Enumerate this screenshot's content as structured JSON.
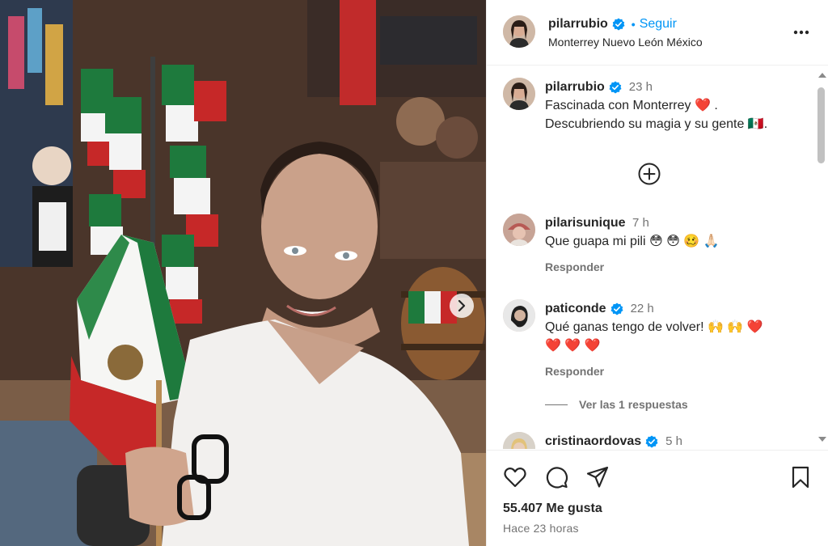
{
  "post": {
    "username": "pilarrubio",
    "follow_label": "Seguir",
    "location": "Monterrey Nuevo León México",
    "caption": {
      "username": "pilarrubio",
      "time": "23 h",
      "line1": "Fascinada con Monterrey",
      "line1_emoji": "❤️",
      "line1_end": ".",
      "line2": "Descubriendo su magia y su gente 🇲🇽."
    },
    "likes": "55.407 Me gusta",
    "time_ago": "Hace 23 horas"
  },
  "comments": [
    {
      "username": "pilarisunique",
      "time": "7 h",
      "text": "Que guapa mi pili 😳 😳 🥴 🙏🏻",
      "reply_label": "Responder"
    },
    {
      "username": "paticonde",
      "verified": true,
      "time": "22 h",
      "text": "Qué ganas tengo de volver! 🙌 🙌",
      "text_hearts": "❤️",
      "text_line2": "❤️ ❤️ ❤️",
      "reply_label": "Responder",
      "view_replies_label": "Ver las 1 respuestas"
    },
    {
      "username": "cristinaordovas",
      "verified": true,
      "time": "5 h"
    }
  ],
  "icons": {
    "verified": "verified-badge-icon",
    "more": "more-options-icon",
    "plus": "plus-circle-icon",
    "like": "heart-outline-icon",
    "comment": "comment-bubble-icon",
    "share": "paper-plane-icon",
    "save": "bookmark-icon",
    "next": "chevron-right-icon"
  },
  "colors": {
    "link_blue": "#0095f6",
    "verified_blue": "#0095f6",
    "heart_red": "#e0245e",
    "muted_text": "#737373"
  }
}
